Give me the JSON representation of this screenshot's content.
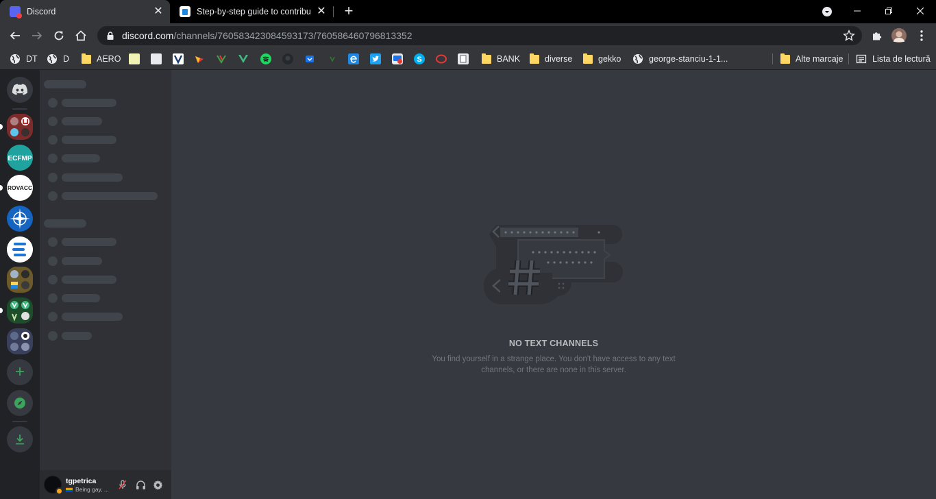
{
  "browser": {
    "tabs": [
      {
        "title": "Discord",
        "favicon": "discord-favicon",
        "active": true
      },
      {
        "title": "Step-by-step guide to contributing",
        "favicon": "guide-favicon",
        "active": false
      }
    ],
    "close_glyph": "✕",
    "newtab_glyph": "+",
    "url_host": "discord.com",
    "url_path": "/channels/760583423084593173/760586460796813352",
    "bookmarks": [
      {
        "label": "DT",
        "icon": "globe-icon"
      },
      {
        "label": "D",
        "icon": "globe-icon"
      },
      {
        "label": "AERO",
        "icon": "folder-icon"
      },
      {
        "label": "",
        "icon": "site-icon-1"
      },
      {
        "label": "",
        "icon": "site-icon-2"
      },
      {
        "label": "",
        "icon": "site-icon-3"
      },
      {
        "label": "",
        "icon": "site-icon-4"
      },
      {
        "label": "",
        "icon": "site-icon-5"
      },
      {
        "label": "",
        "icon": "vue-icon"
      },
      {
        "label": "",
        "icon": "spotify-icon"
      },
      {
        "label": "",
        "icon": "github-icon"
      },
      {
        "label": "",
        "icon": "pocket-icon"
      },
      {
        "label": "",
        "icon": "site-icon-6"
      },
      {
        "label": "",
        "icon": "edge-icon"
      },
      {
        "label": "",
        "icon": "twitter-icon"
      },
      {
        "label": "",
        "icon": "site-icon-7"
      },
      {
        "label": "",
        "icon": "skype-icon"
      },
      {
        "label": "",
        "icon": "opera-icon"
      },
      {
        "label": "",
        "icon": "site-icon-8"
      },
      {
        "label": "BANK",
        "icon": "folder-icon"
      },
      {
        "label": "diverse",
        "icon": "folder-icon"
      },
      {
        "label": "gekko",
        "icon": "folder-icon"
      },
      {
        "label": "george-stanciu-1-1...",
        "icon": "globe-icon"
      }
    ],
    "other_bookmarks": "Alte marcaje",
    "reading_list": "Lista de lectură"
  },
  "discord": {
    "home_icon": "discord-logo-icon",
    "servers": [
      {
        "name": "server-folder-1",
        "initials": ""
      },
      {
        "name": "ECFMP",
        "initials": "ECFMP"
      },
      {
        "name": "ROVACC",
        "initials": "ROVACC"
      },
      {
        "name": "server-nato",
        "initials": ""
      },
      {
        "name": "server-e",
        "initials": ""
      },
      {
        "name": "server-folder-2",
        "initials": ""
      },
      {
        "name": "server-folder-3",
        "initials": ""
      },
      {
        "name": "server-folder-4",
        "initials": ""
      }
    ],
    "add_server_glyph": "+",
    "user": {
      "name": "tgpetrica",
      "status": "Being gay, ..."
    },
    "empty_state": {
      "title": "NO TEXT CHANNELS",
      "text": "You find yourself in a strange place. You don't have access to any text channels, or there are none in this server."
    },
    "colors": {
      "accent_green": "#3ba55d",
      "blurple": "#5865f2",
      "idle": "#faa61a"
    }
  }
}
